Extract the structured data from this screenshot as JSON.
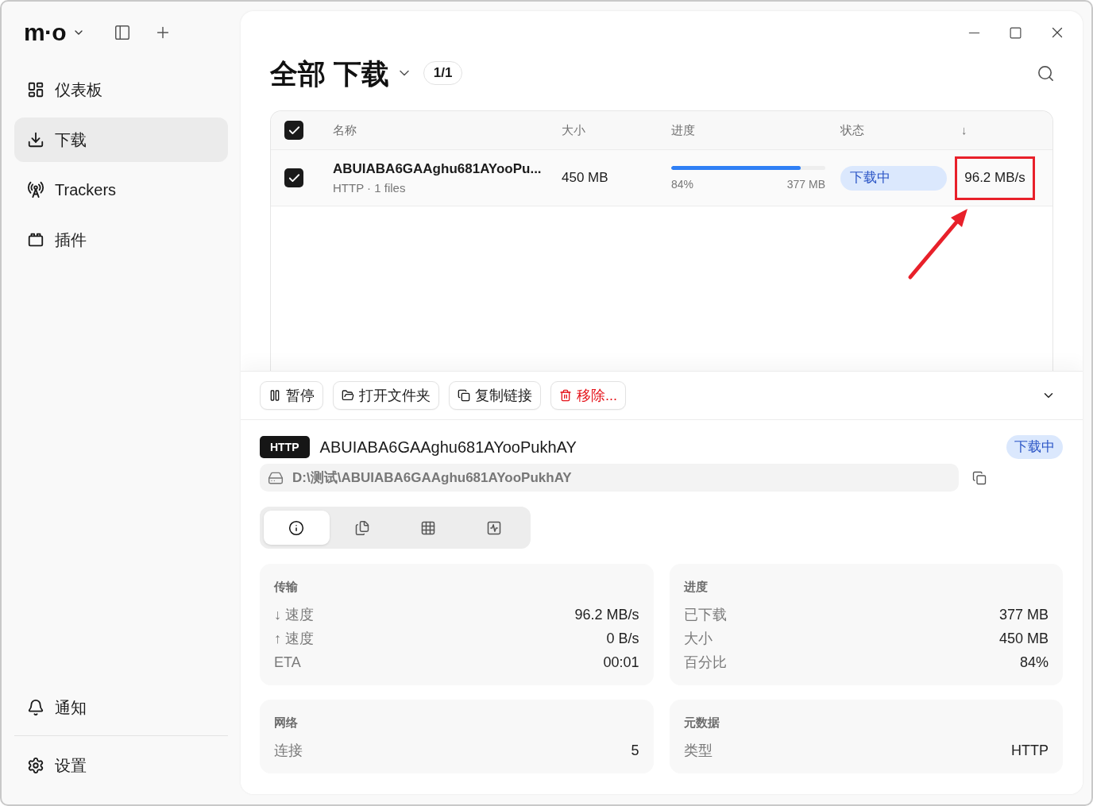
{
  "app": {
    "logo": "m·o"
  },
  "sidebar": {
    "items": [
      {
        "label": "仪表板",
        "selected": false
      },
      {
        "label": "下载",
        "selected": true
      },
      {
        "label": "Trackers",
        "selected": false
      },
      {
        "label": "插件",
        "selected": false
      }
    ],
    "bottom_items": [
      {
        "label": "通知"
      },
      {
        "label": "设置"
      }
    ]
  },
  "header": {
    "title": "全部 下载",
    "count": "1/1"
  },
  "table": {
    "all_checked": true,
    "columns": [
      "名称",
      "大小",
      "进度",
      "状态",
      "↓"
    ],
    "rows": [
      {
        "checked": true,
        "name": "ABUIABA6GAAghu681AYooPu...",
        "subtitle": "HTTP · 1 files",
        "size": "450 MB",
        "level": 0.84,
        "percent": "84%",
        "downloaded": "377 MB",
        "status": "下载中",
        "speed": "96.2 MB/s",
        "highlighted": true
      }
    ]
  },
  "toolbar": {
    "buttons": [
      {
        "label": "暂停",
        "kind": "pause"
      },
      {
        "label": "打开文件夹",
        "kind": "folder"
      },
      {
        "label": "复制链接",
        "kind": "copy"
      },
      {
        "label": "移除...",
        "kind": "remove"
      }
    ]
  },
  "detail": {
    "protocol": "HTTP",
    "name": "ABUIABA6GAAghu681AYooPukhAY",
    "status": "下载中",
    "path": "D:\\测试\\ABUIABA6GAAghu681AYooPukhAY",
    "tabs": [
      {
        "selected": true
      },
      {
        "selected": false
      },
      {
        "selected": false
      },
      {
        "selected": false
      }
    ]
  },
  "cards": [
    {
      "title": "传输",
      "rows": [
        {
          "label": "↓ 速度",
          "value": "96.2 MB/s"
        },
        {
          "label": "↑ 速度",
          "value": "0 B/s"
        },
        {
          "label": "ETA",
          "value": "00:01"
        }
      ]
    },
    {
      "title": "进度",
      "rows": [
        {
          "label": "已下载",
          "value": "377 MB"
        },
        {
          "label": "大小",
          "value": "450 MB"
        },
        {
          "label": "百分比",
          "value": "84%"
        }
      ]
    },
    {
      "title": "网络",
      "rows": [
        {
          "label": "连接",
          "value": "5"
        }
      ]
    },
    {
      "title": "元数据",
      "rows": [
        {
          "label": "类型",
          "value": "HTTP"
        }
      ]
    }
  ]
}
